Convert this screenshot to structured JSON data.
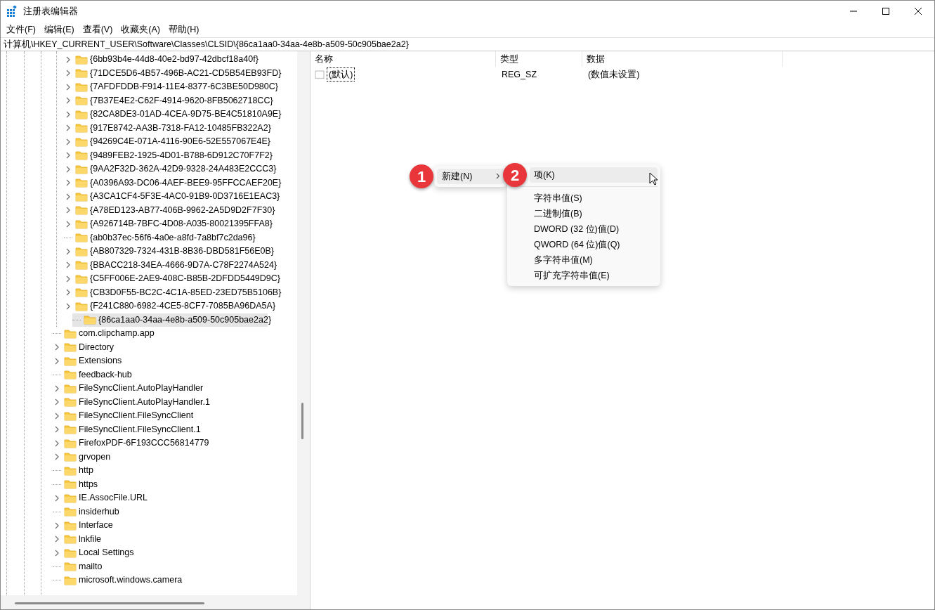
{
  "window": {
    "title": "注册表编辑器"
  },
  "menu": [
    "文件(F)",
    "编辑(E)",
    "查看(V)",
    "收藏夹(A)",
    "帮助(H)"
  ],
  "address": "计算机\\HKEY_CURRENT_USER\\Software\\Classes\\CLSID\\{86ca1aa0-34aa-4e8b-a509-50c905bae2a2}",
  "tree": {
    "nodes": [
      {
        "children": [
          {
            "label": "{6bb93b4e-44d8-40e2-bd97-42dbcf18a40f}",
            "expandable": true,
            "selected": false
          },
          {
            "label": "{71DCE5D6-4B57-496B-AC21-CD5B54EB93FD}",
            "expandable": true,
            "selected": false
          },
          {
            "label": "{7AFDFDDB-F914-11E4-8377-6C3BE50D980C}",
            "expandable": true,
            "selected": false
          },
          {
            "label": "{7B37E4E2-C62F-4914-9620-8FB5062718CC}",
            "expandable": true,
            "selected": false
          },
          {
            "label": "{82CA8DE3-01AD-4CEA-9D75-BE4C51810A9E}",
            "expandable": true,
            "selected": false
          },
          {
            "label": "{917E8742-AA3B-7318-FA12-10485FB322A2}",
            "expandable": true,
            "selected": false
          },
          {
            "label": "{94269C4E-071A-4116-90E6-52E557067E4E}",
            "expandable": true,
            "selected": false
          },
          {
            "label": "{9489FEB2-1925-4D01-B788-6D912C70F7F2}",
            "expandable": true,
            "selected": false
          },
          {
            "label": "{9AA2F32D-362A-42D9-9328-24A483E2CCC3}",
            "expandable": true,
            "selected": false
          },
          {
            "label": "{A0396A93-DC06-4AEF-BEE9-95FFCCAEF20E}",
            "expandable": true,
            "selected": false
          },
          {
            "label": "{A3CA1CF4-5F3E-4AC0-91B9-0D3716E1EAC3}",
            "expandable": true,
            "selected": false
          },
          {
            "label": "{A78ED123-AB77-406B-9962-2A5D9D2F7F30}",
            "expandable": true,
            "selected": false
          },
          {
            "label": "{A926714B-7BFC-4D08-A035-80021395FFA8}",
            "expandable": true,
            "selected": false
          },
          {
            "label": "{ab0b37ec-56f6-4a0e-a8fd-7a8bf7c2da96}",
            "expandable": false,
            "selected": false
          },
          {
            "label": "{AB807329-7324-431B-8B36-DBD581F56E0B}",
            "expandable": true,
            "selected": false
          },
          {
            "label": "{BBACC218-34EA-4666-9D7A-C78F2274A524}",
            "expandable": true,
            "selected": false
          },
          {
            "label": "{C5FF006E-2AE9-408C-B85B-2DFDD5449D9C}",
            "expandable": true,
            "selected": false
          },
          {
            "label": "{CB3D0F55-BC2C-4C1A-85ED-23ED75B5106B}",
            "expandable": true,
            "selected": false
          },
          {
            "label": "{F241C880-6982-4CE5-8CF7-7085BA96DA5A}",
            "expandable": true,
            "selected": false
          },
          {
            "label": "{86ca1aa0-34aa-4e8b-a509-50c905bae2a2}",
            "expandable": false,
            "selected": true
          }
        ]
      },
      {
        "label": "com.clipchamp.app",
        "expandable": false,
        "selected": false
      },
      {
        "label": "Directory",
        "expandable": true,
        "selected": false
      },
      {
        "label": "Extensions",
        "expandable": true,
        "selected": false
      },
      {
        "label": "feedback-hub",
        "expandable": false,
        "selected": false
      },
      {
        "label": "FileSyncClient.AutoPlayHandler",
        "expandable": true,
        "selected": false
      },
      {
        "label": "FileSyncClient.AutoPlayHandler.1",
        "expandable": true,
        "selected": false
      },
      {
        "label": "FileSyncClient.FileSyncClient",
        "expandable": true,
        "selected": false
      },
      {
        "label": "FileSyncClient.FileSyncClient.1",
        "expandable": true,
        "selected": false
      },
      {
        "label": "FirefoxPDF-6F193CCC56814779",
        "expandable": true,
        "selected": false
      },
      {
        "label": "grvopen",
        "expandable": true,
        "selected": false
      },
      {
        "label": "http",
        "expandable": false,
        "selected": false
      },
      {
        "label": "https",
        "expandable": false,
        "selected": false
      },
      {
        "label": "IE.AssocFile.URL",
        "expandable": true,
        "selected": false
      },
      {
        "label": "insiderhub",
        "expandable": false,
        "selected": false
      },
      {
        "label": "Interface",
        "expandable": true,
        "selected": false
      },
      {
        "label": "lnkfile",
        "expandable": true,
        "selected": false
      },
      {
        "label": "Local Settings",
        "expandable": true,
        "selected": false
      },
      {
        "label": "mailto",
        "expandable": false,
        "selected": false
      },
      {
        "label": "microsoft.windows.camera",
        "expandable": false,
        "selected": false
      }
    ]
  },
  "values": {
    "columns": [
      "名称",
      "类型",
      "数据"
    ],
    "rows": [
      {
        "name": "(默认)",
        "type": "REG_SZ",
        "data": "(数值未设置)",
        "focused": true
      }
    ]
  },
  "context_menu": {
    "items": [
      {
        "label": "新建(N)",
        "callout": "1",
        "submenu": true,
        "selected": true
      }
    ]
  },
  "submenu": {
    "items": [
      {
        "label": "项(K)",
        "callout": "2",
        "selected": true,
        "separator_after": true
      },
      {
        "label": "字符串值(S)",
        "selected": false
      },
      {
        "label": "二进制值(B)",
        "selected": false
      },
      {
        "label": "DWORD (32 位)值(D)",
        "selected": false
      },
      {
        "label": "QWORD (64 位)值(Q)",
        "selected": false
      },
      {
        "label": "多字符串值(M)",
        "selected": false
      },
      {
        "label": "可扩充字符串值(E)",
        "selected": false
      }
    ]
  }
}
